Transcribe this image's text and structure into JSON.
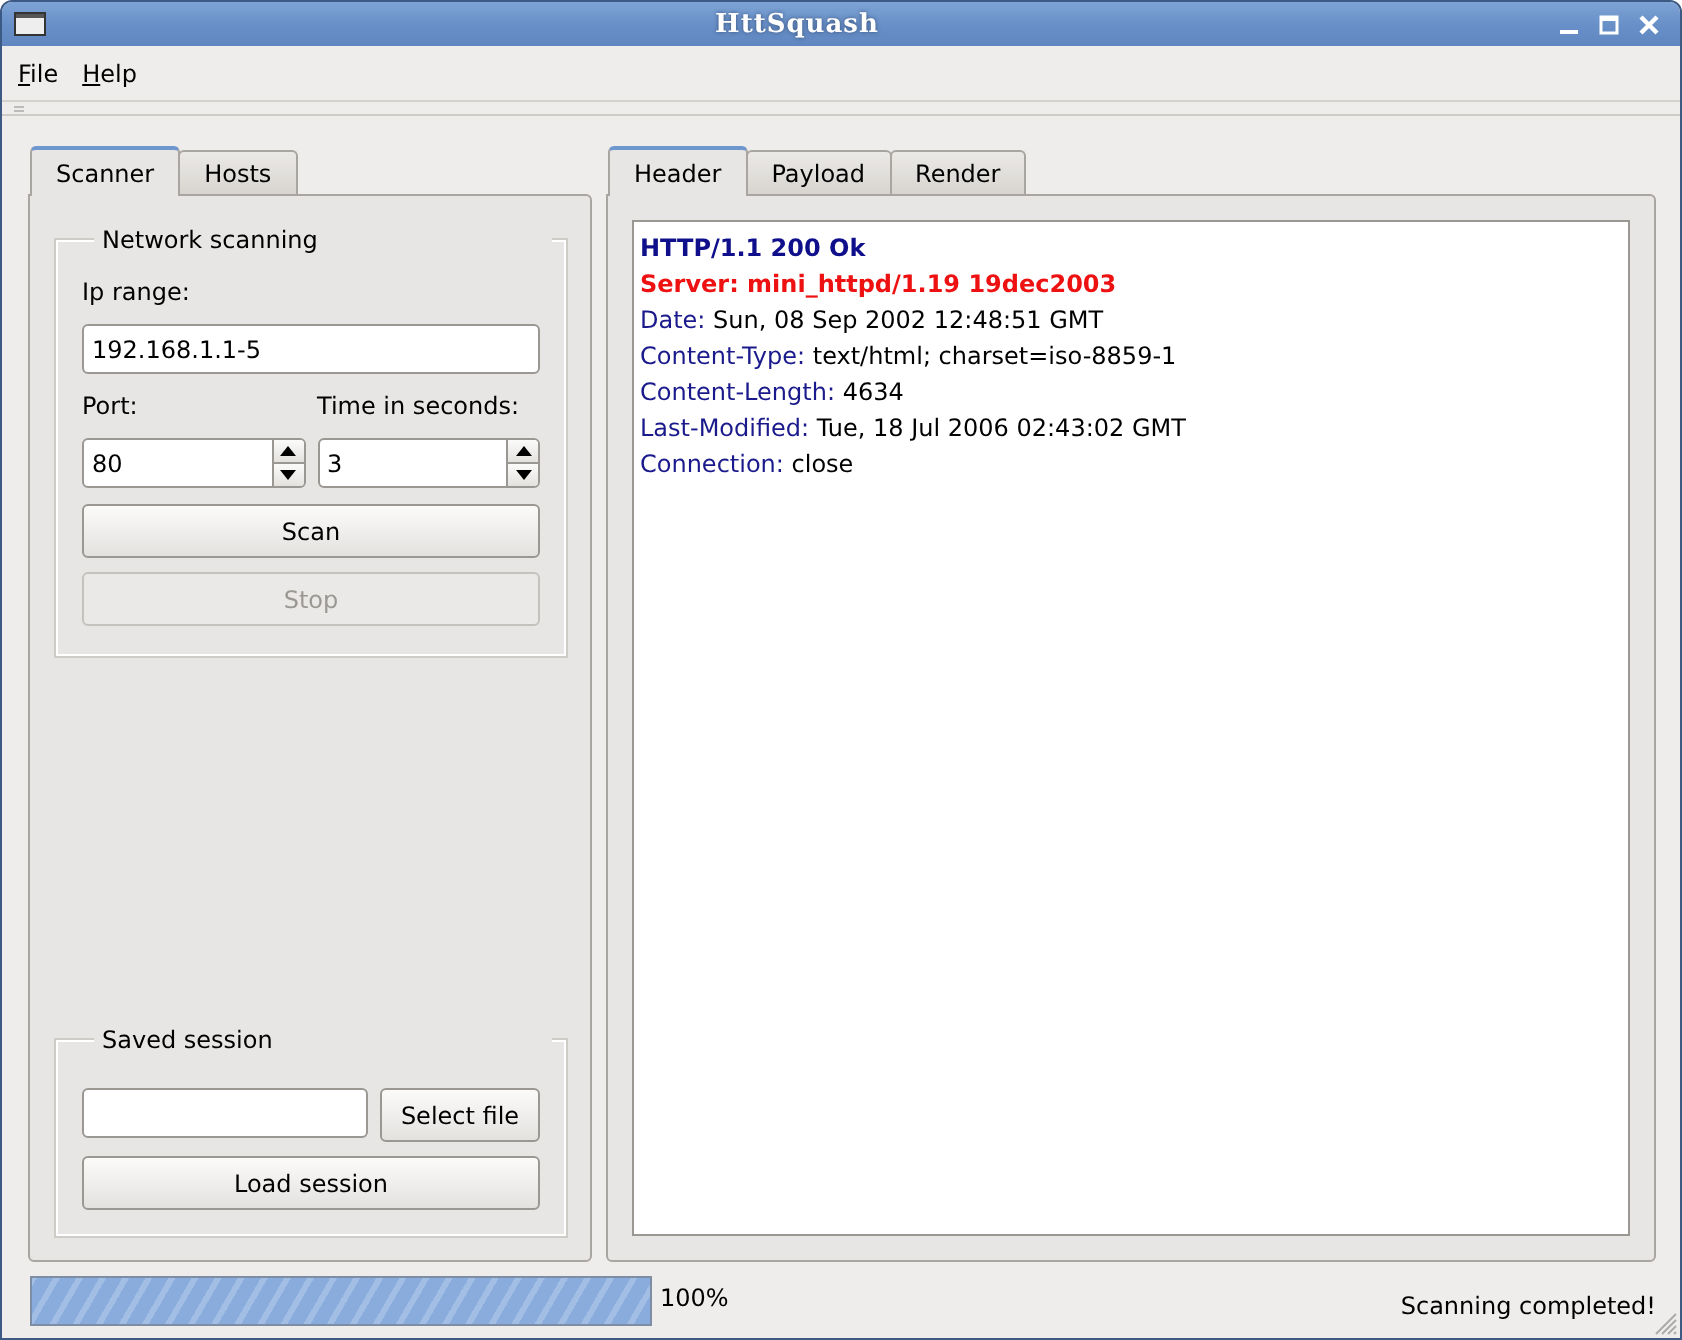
{
  "window": {
    "title": "HttSquash"
  },
  "menu": [
    {
      "label": "File"
    },
    {
      "label": "Help"
    }
  ],
  "left_tabs": [
    {
      "label": "Scanner",
      "selected": true
    },
    {
      "label": "Hosts",
      "selected": false
    }
  ],
  "network_scanning": {
    "title": "Network scanning",
    "ip_label": "Ip range:",
    "ip_value": "192.168.1.1-5",
    "port_label": "Port:",
    "port_value": "80",
    "time_label": "Time in seconds:",
    "time_value": "3",
    "scan_button": {
      "label": "Scan",
      "disabled": false
    },
    "stop_button": {
      "label": "Stop",
      "disabled": true
    }
  },
  "saved_session": {
    "title": "Saved session",
    "select_button": "Select file",
    "load_button": "Load session"
  },
  "right_tabs": [
    {
      "label": "Header",
      "selected": true
    },
    {
      "label": "Payload",
      "selected": false
    },
    {
      "label": "Render",
      "selected": false
    }
  ],
  "header_lines": [
    {
      "kind": "status",
      "text": "HTTP/1.1 200 Ok"
    },
    {
      "kind": "server",
      "text": "Server: mini_httpd/1.19 19dec2003"
    },
    {
      "kind": "field",
      "key": "Date:",
      "value": "Sun, 08 Sep 2002 12:48:51 GMT"
    },
    {
      "kind": "field",
      "key": "Content-Type:",
      "value": "text/html; charset=iso-8859-1"
    },
    {
      "kind": "field",
      "key": "Content-Length:",
      "value": "4634"
    },
    {
      "kind": "field",
      "key": "Last-Modified:",
      "value": "Tue, 18 Jul 2006 02:43:02 GMT"
    },
    {
      "kind": "field",
      "key": "Connection:",
      "value": "close"
    }
  ],
  "progress": {
    "level": 1,
    "reading": "100%"
  },
  "status_bar": "Scanning completed!"
}
